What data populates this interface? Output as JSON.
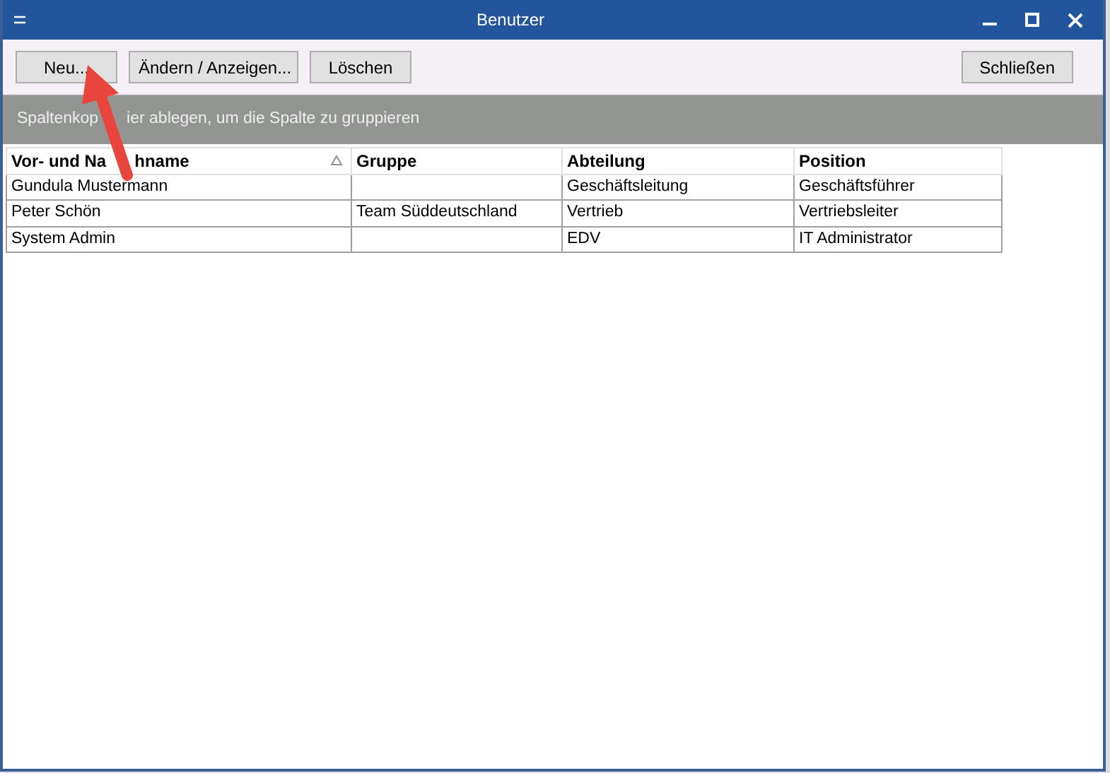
{
  "window": {
    "title": "Benutzer"
  },
  "toolbar": {
    "buttons": [
      {
        "label": "Neu..."
      },
      {
        "label": "Ändern / Anzeigen..."
      },
      {
        "label": "Löschen"
      }
    ],
    "close_button": "Schließen"
  },
  "group_panel": {
    "hint_parts": [
      "Spaltenkop",
      "ier ablegen, um die Spalte zu gruppieren"
    ]
  },
  "table": {
    "columns": [
      {
        "label_parts": [
          "Vor- und Na",
          "hname"
        ],
        "sorted": true
      },
      {
        "label_parts": [
          "Gruppe"
        ],
        "sorted": false
      },
      {
        "label_parts": [
          "Abteilung"
        ],
        "sorted": false
      },
      {
        "label_parts": [
          "Position"
        ],
        "sorted": false
      }
    ],
    "rows": [
      [
        "Gundula Mustermann",
        "",
        "Geschäftsleitung",
        "Geschäftsführer"
      ],
      [
        "Peter Schön",
        "Team Süddeutschland",
        "Vertrieb",
        "Vertriebsleiter"
      ],
      [
        "System Admin",
        "",
        "EDV",
        "IT Administrator"
      ]
    ]
  }
}
